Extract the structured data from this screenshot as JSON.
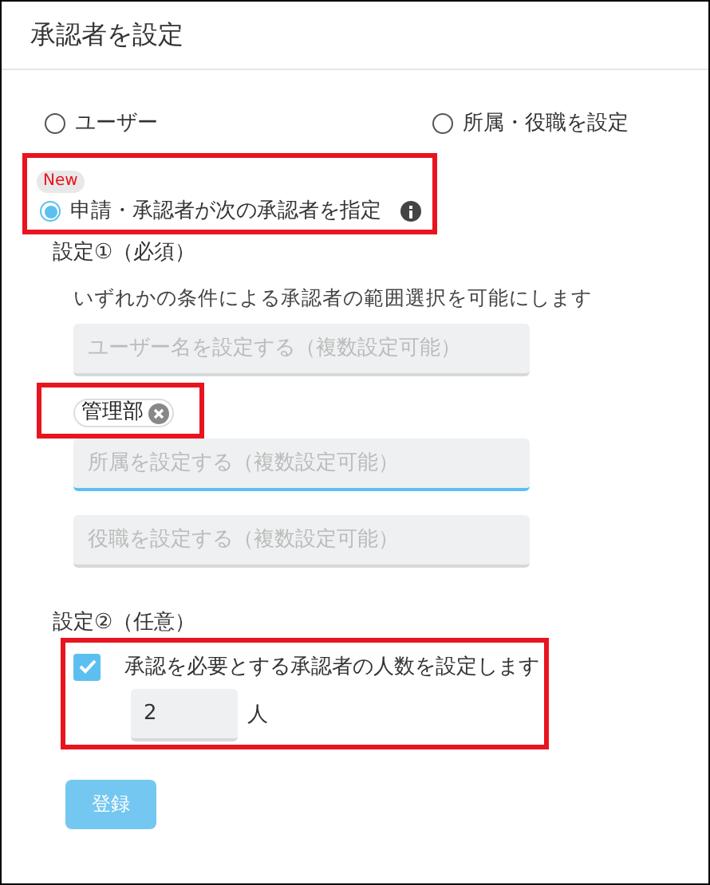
{
  "dialog": {
    "title": "承認者を設定"
  },
  "approver_options": [
    {
      "label": "ユーザー",
      "selected": false
    },
    {
      "label": "所属・役職を設定",
      "selected": false
    },
    {
      "label": "申請・承認者が次の承認者を指定",
      "selected": true,
      "badge": "New",
      "info_icon": true,
      "highlighted": true
    }
  ],
  "setting_1": {
    "heading": "設定①（必須）",
    "description": "いずれかの条件による承認者の範囲選択を可能にします",
    "fields": [
      {
        "placeholder": "ユーザー名を設定する（複数設定可能）",
        "focused": false
      },
      {
        "placeholder": "所属を設定する（複数設定可能）",
        "focused": true,
        "chips": [
          {
            "label": "管理部"
          }
        ],
        "chips_highlighted": true
      },
      {
        "placeholder": "役職を設定する（複数設定可能）",
        "focused": false
      }
    ]
  },
  "setting_2": {
    "heading": "設定②（任意）",
    "highlighted": true,
    "checkbox": {
      "label": "承認を必要とする承認者の人数を設定します",
      "checked": true
    },
    "count": {
      "value": "2",
      "unit": "人"
    }
  },
  "submit_button": {
    "label": "登録",
    "disabled": true
  }
}
